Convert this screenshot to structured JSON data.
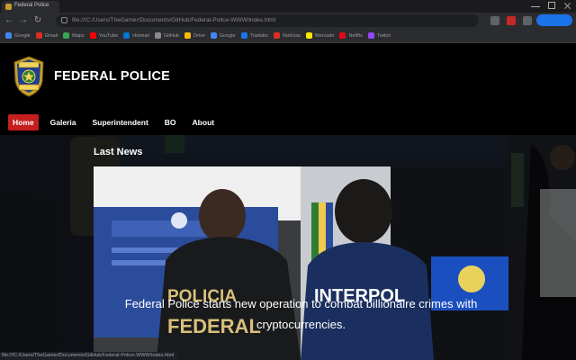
{
  "browser": {
    "tab_title": "Federal Police",
    "url": "file:///C:/Users/TheGamer/Documents/GitHub/Federal-Police-WWW/index.html",
    "bookmarks": [
      {
        "label": "Google",
        "color": "#4285f4"
      },
      {
        "label": "Gmail",
        "color": "#d93025"
      },
      {
        "label": "Maps",
        "color": "#34a853"
      },
      {
        "label": "YouTube",
        "color": "#ff0000"
      },
      {
        "label": "Hotmail",
        "color": "#0078d4"
      },
      {
        "label": "GitHub",
        "color": "#8a8a8a"
      },
      {
        "label": "Drive",
        "color": "#fbbc04"
      },
      {
        "label": "Google",
        "color": "#4285f4"
      },
      {
        "label": "Tradutor",
        "color": "#1a73e8"
      },
      {
        "label": "Notícias",
        "color": "#d93025"
      },
      {
        "label": "Mercado",
        "color": "#ffe600"
      },
      {
        "label": "Netflix",
        "color": "#e50914"
      },
      {
        "label": "Twitch",
        "color": "#9146ff"
      }
    ],
    "status_url": "file:///C:/Users/TheGamer/Documents/GitHub/Federal-Police-WWW/index.html"
  },
  "site": {
    "title": "FEDERAL POLICE",
    "logo_alt": "Polícia Federal badge",
    "nav": [
      {
        "label": "Home",
        "active": true
      },
      {
        "label": "Galeria",
        "active": false
      },
      {
        "label": "Superintendent",
        "active": false
      },
      {
        "label": "BO",
        "active": false
      },
      {
        "label": "About",
        "active": false
      }
    ],
    "accent_color": "#c41f1f"
  },
  "news": {
    "heading": "Last News",
    "caption": "Federal Police starts new operation to combat billionaire crimes with cryptocurrencies.",
    "image_text": {
      "left_jacket": "POLICIA FEDERAL",
      "right_jacket": "INTERPOL"
    }
  }
}
